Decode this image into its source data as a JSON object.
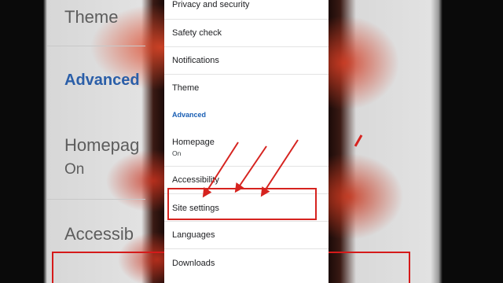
{
  "background": {
    "left_texts": {
      "theme": "Theme",
      "advanced": "Advanced",
      "homepage": "Homepag",
      "homepage_value": "On",
      "accessibility": "Accessib"
    }
  },
  "settings": {
    "items": [
      {
        "label": "Privacy and security"
      },
      {
        "label": "Safety check"
      },
      {
        "label": "Notifications"
      },
      {
        "label": "Theme"
      }
    ],
    "section_header": "Advanced",
    "advanced_items": [
      {
        "label": "Homepage",
        "value": "On"
      },
      {
        "label": "Accessibility"
      },
      {
        "label": "Site settings"
      },
      {
        "label": "Languages"
      },
      {
        "label": "Downloads"
      }
    ]
  },
  "colors": {
    "accent_blue": "#1a5fb4",
    "annotation_red": "#d6231f"
  }
}
